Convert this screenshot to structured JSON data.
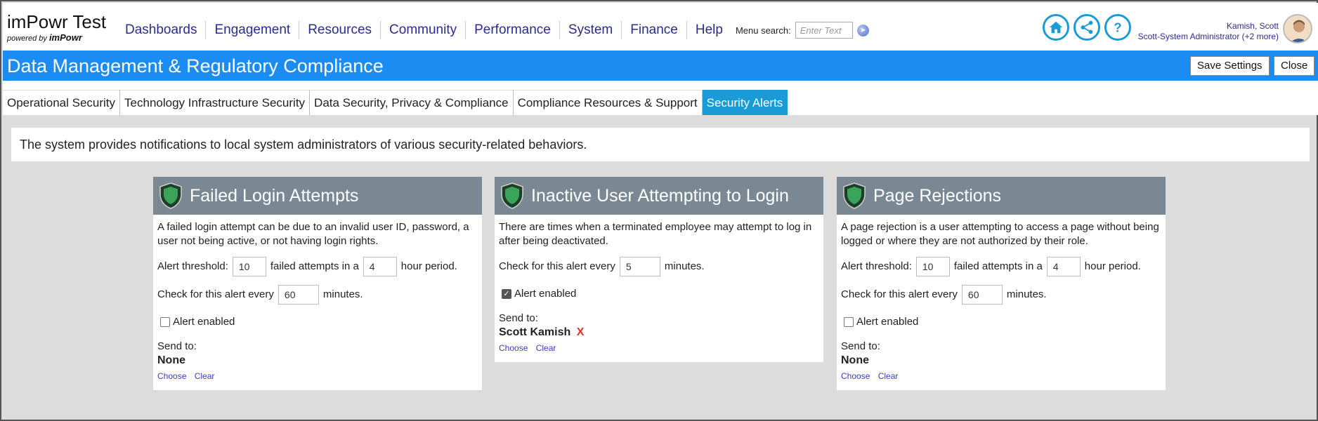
{
  "header": {
    "app_title": "imPowr Test",
    "powered_by": "powered by",
    "powered_brand": "imPowr",
    "nav": [
      "Dashboards",
      "Engagement",
      "Resources",
      "Community",
      "Performance",
      "System",
      "Finance",
      "Help"
    ],
    "menu_search_label": "Menu search:",
    "menu_search_placeholder": "Enter Text",
    "user_name": "Kamish, Scott",
    "user_role": "Scott-System Administrator (+2 more)"
  },
  "titlebar": {
    "title": "Data Management & Regulatory Compliance",
    "save_label": "Save Settings",
    "close_label": "Close"
  },
  "tabs": [
    "Operational Security",
    "Technology Infrastructure Security",
    "Data Security, Privacy & Compliance",
    "Compliance Resources & Support",
    "Security Alerts"
  ],
  "intro": "The system provides notifications to local system administrators of various security-related behaviors.",
  "cards": [
    {
      "title": "Failed Login Attempts",
      "description": "A failed login attempt can be due to an invalid user ID, password, a user not being active, or not having login rights.",
      "threshold_label": "Alert threshold:",
      "threshold_value": "10",
      "attempts_label": "failed attempts in a",
      "hours_value": "4",
      "hours_label": "hour period.",
      "check_label": "Check for this alert every",
      "check_value": "60",
      "minutes_label": "minutes.",
      "enabled_label": "Alert enabled",
      "enabled": false,
      "send_to_label": "Send to:",
      "recipient": "None",
      "choose": "Choose",
      "clear": "Clear"
    },
    {
      "title": "Inactive User Attempting to Login",
      "description": "There are times when a terminated employee may attempt to log in after being deactivated.",
      "check_label": "Check for this alert every",
      "check_value": "5",
      "minutes_label": "minutes.",
      "enabled_label": "Alert enabled",
      "enabled": true,
      "send_to_label": "Send to:",
      "recipient": "Scott Kamish",
      "remove": "X",
      "choose": "Choose",
      "clear": "Clear"
    },
    {
      "title": "Page Rejections",
      "description": "A page rejection is a user attempting to access a page without being logged or where they are not authorized by their role.",
      "threshold_label": "Alert threshold:",
      "threshold_value": "10",
      "attempts_label": "failed attempts in a",
      "hours_value": "4",
      "hours_label": "hour period.",
      "check_label": "Check for this alert every",
      "check_value": "60",
      "minutes_label": "minutes.",
      "enabled_label": "Alert enabled",
      "enabled": false,
      "send_to_label": "Send to:",
      "recipient": "None",
      "choose": "Choose",
      "clear": "Clear"
    }
  ]
}
